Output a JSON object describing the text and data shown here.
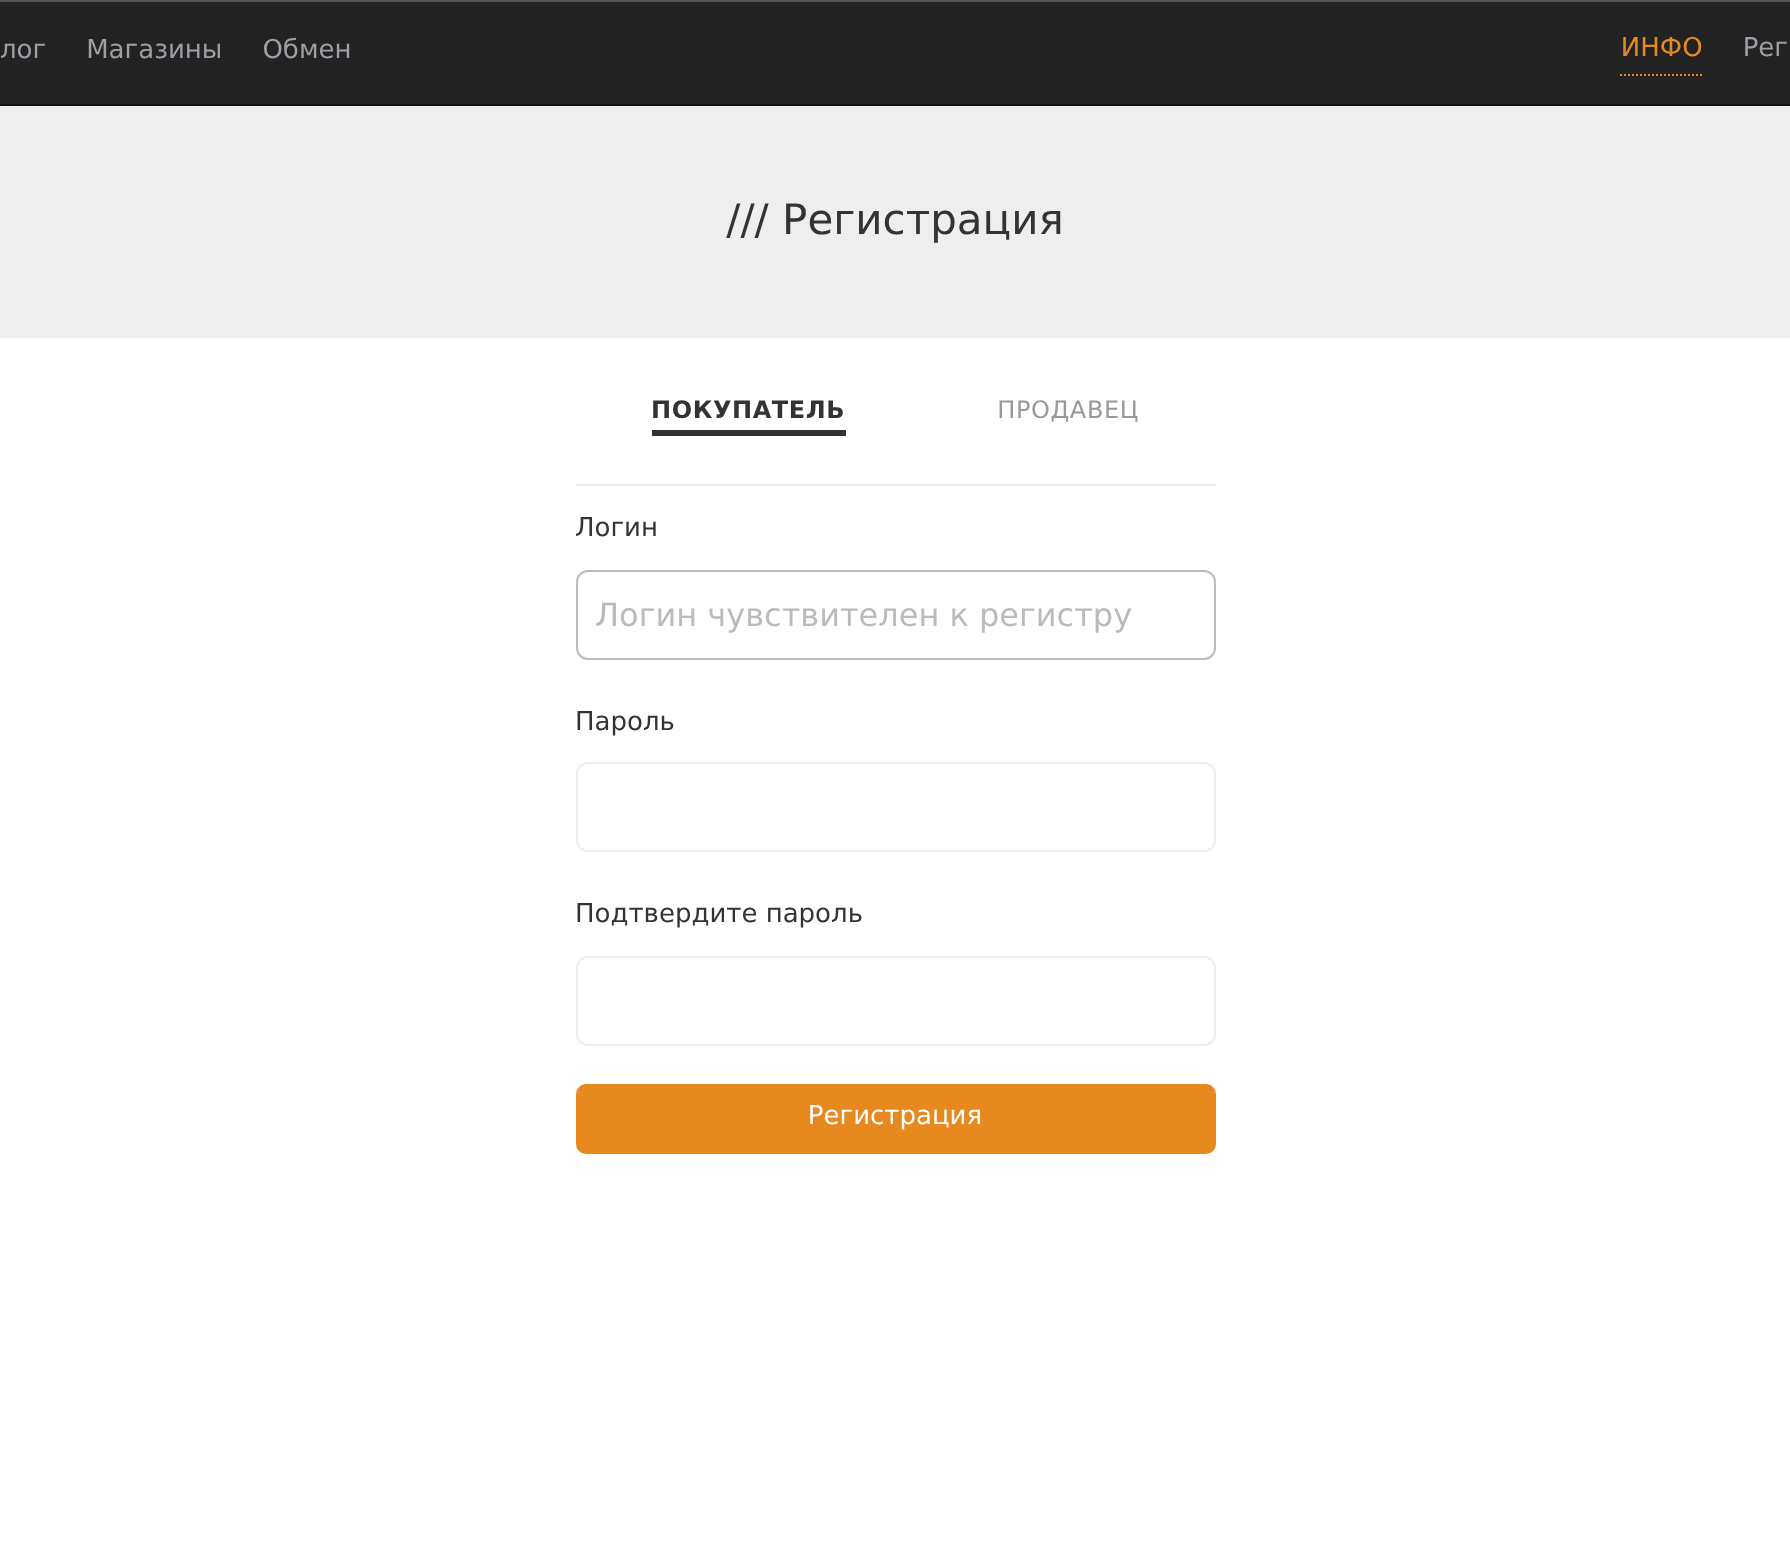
{
  "nav": {
    "left": [
      {
        "label": "лог",
        "selected": false
      },
      {
        "label": "Магазины",
        "selected": false
      },
      {
        "label": "Обмен",
        "selected": false
      }
    ],
    "right": [
      {
        "label": "ИНФО",
        "selected": true
      },
      {
        "label": "Рег",
        "selected": false
      }
    ]
  },
  "page_title": "/// Регистрация",
  "tabs": [
    {
      "label": "ПОКУПАТЕЛЬ",
      "selected": true
    },
    {
      "label": "ПРОДАВЕЦ",
      "selected": false
    }
  ],
  "fields": [
    {
      "label": "Логин",
      "placeholder": "Логин чувствителен к регистру",
      "focused": true
    },
    {
      "label": "Пароль",
      "focused": false
    },
    {
      "label": "Подтвердите пароль",
      "focused": false
    }
  ],
  "submit": "Регистрация"
}
